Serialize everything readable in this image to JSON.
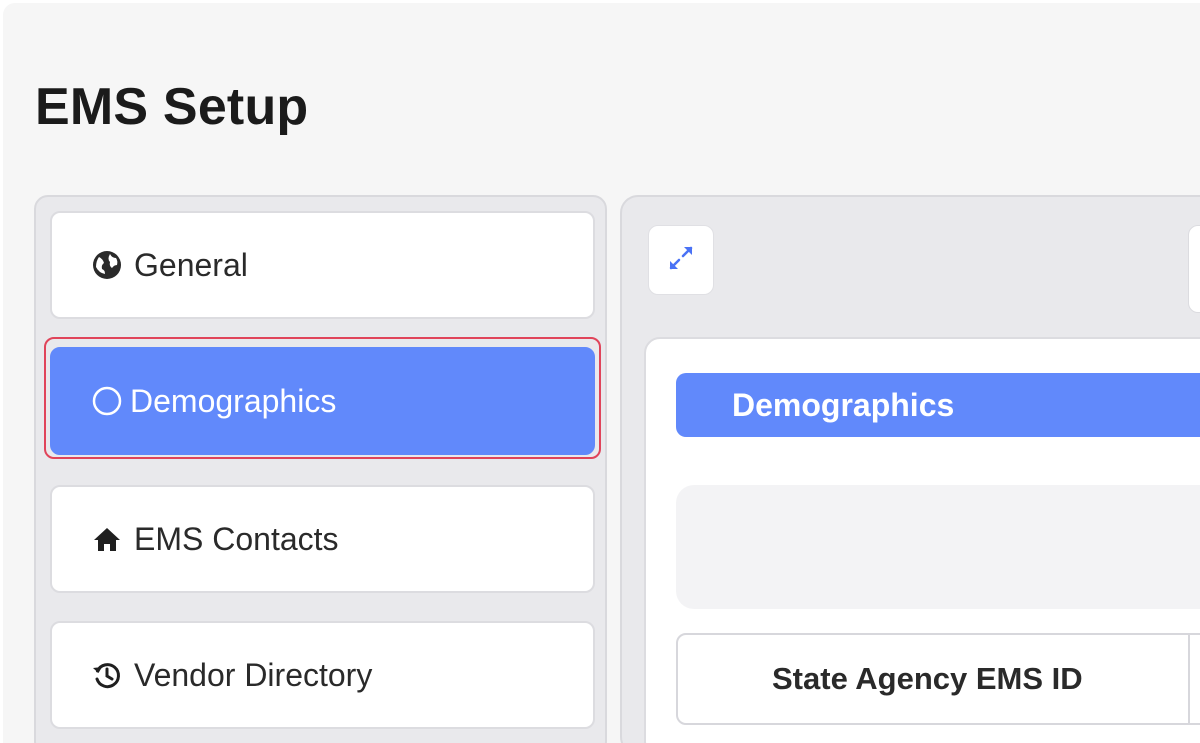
{
  "page": {
    "title": "EMS Setup"
  },
  "sidebar": {
    "items": [
      {
        "label": "General",
        "icon": "globe-icon"
      },
      {
        "label": "Demographics",
        "icon": "circle-icon",
        "active": true
      },
      {
        "label": "EMS Contacts",
        "icon": "home-icon"
      },
      {
        "label": "Vendor Directory",
        "icon": "history-icon"
      }
    ]
  },
  "panel": {
    "expand_icon": "expand-arrows-icon",
    "section_title": "Demographics",
    "field_label": "State Agency EMS ID"
  },
  "colors": {
    "accent": "#6189fb",
    "focus_ring": "#e0445a",
    "background": "#f6f6f6"
  }
}
